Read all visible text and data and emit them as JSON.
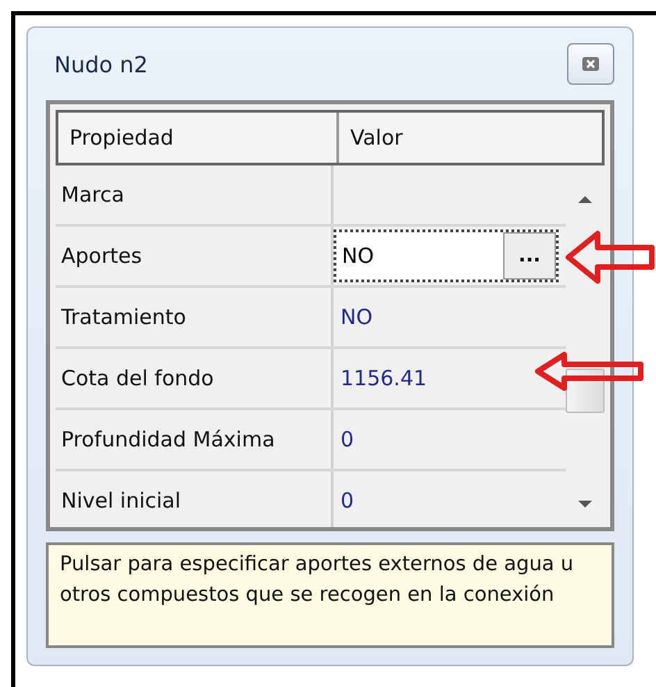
{
  "window": {
    "title": "Nudo n2"
  },
  "table": {
    "columns": [
      "Propiedad",
      "Valor"
    ],
    "rows": [
      {
        "property": "Marca",
        "kind": "text"
      },
      {
        "property": "Aportes",
        "value": "NO",
        "kind": "editor",
        "button": "..."
      },
      {
        "property": "Tratamiento",
        "value": "NO",
        "kind": "text"
      },
      {
        "property": "Cota del fondo",
        "value": "1156.41",
        "kind": "text"
      },
      {
        "property": "Profundidad Máxima",
        "value": "0",
        "kind": "text"
      },
      {
        "property": "Nivel inicial",
        "value": "0",
        "kind": "text"
      }
    ]
  },
  "hint": "Pulsar para especificar aportes externos de agua u otros compuestos que se recogen en la conexión"
}
